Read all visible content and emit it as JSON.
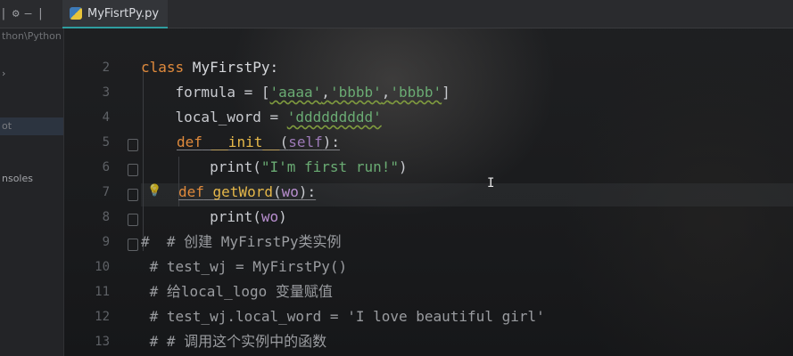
{
  "tab": {
    "filename": "MyFisrtPy.py"
  },
  "sidebar": {
    "path_fragment": "thon\\Python",
    "selected_fragment": "ot",
    "consoles_label": "nsoles"
  },
  "code": {
    "line_numbers": [
      "2",
      "3",
      "4",
      "5",
      "6",
      "7",
      "8",
      "9",
      "10",
      "11",
      "12",
      "13"
    ],
    "l2": {
      "kw": "class",
      "name": " MyFirstPy:"
    },
    "l3": {
      "pre": "    formula = [",
      "s1": "'aaaa'",
      "c1": ",",
      "s2": "'bbbb'",
      "c2": ",",
      "s3": "'bbbb'",
      "post": "]"
    },
    "l4": {
      "pre": "    local_word = ",
      "s1": "'ddddddddd'"
    },
    "l5": {
      "kw": "def",
      "name": " __init__",
      "open": "(",
      "self": "self",
      "close": "):"
    },
    "l6": {
      "pre": "        print(",
      "s1": "\"I'm first run!\"",
      "post": ")"
    },
    "l7": {
      "kw": "def",
      "name": " getWord",
      "open": "(",
      "param": "wo",
      "close": "):"
    },
    "l8": {
      "pre": "        print(",
      "param": "wo",
      "post": ")"
    },
    "l9": {
      "text": "#  # 创建 MyFirstPy类实例"
    },
    "l10": {
      "text": " # test_wj = MyFirstPy()"
    },
    "l11": {
      "text": " # 给local_logo 变量赋值"
    },
    "l12": {
      "text": " # test_wj.local_word = 'I love beautiful girl'"
    },
    "l13": {
      "text": " # # 调用这个实例中的函数"
    }
  },
  "colors": {
    "keyword": "#e08a3c",
    "function": "#e6b84a",
    "string": "#6aab73",
    "self": "#9d7ab8",
    "comment": "#9a9ca0",
    "tab_accent": "#2e9ea0"
  }
}
